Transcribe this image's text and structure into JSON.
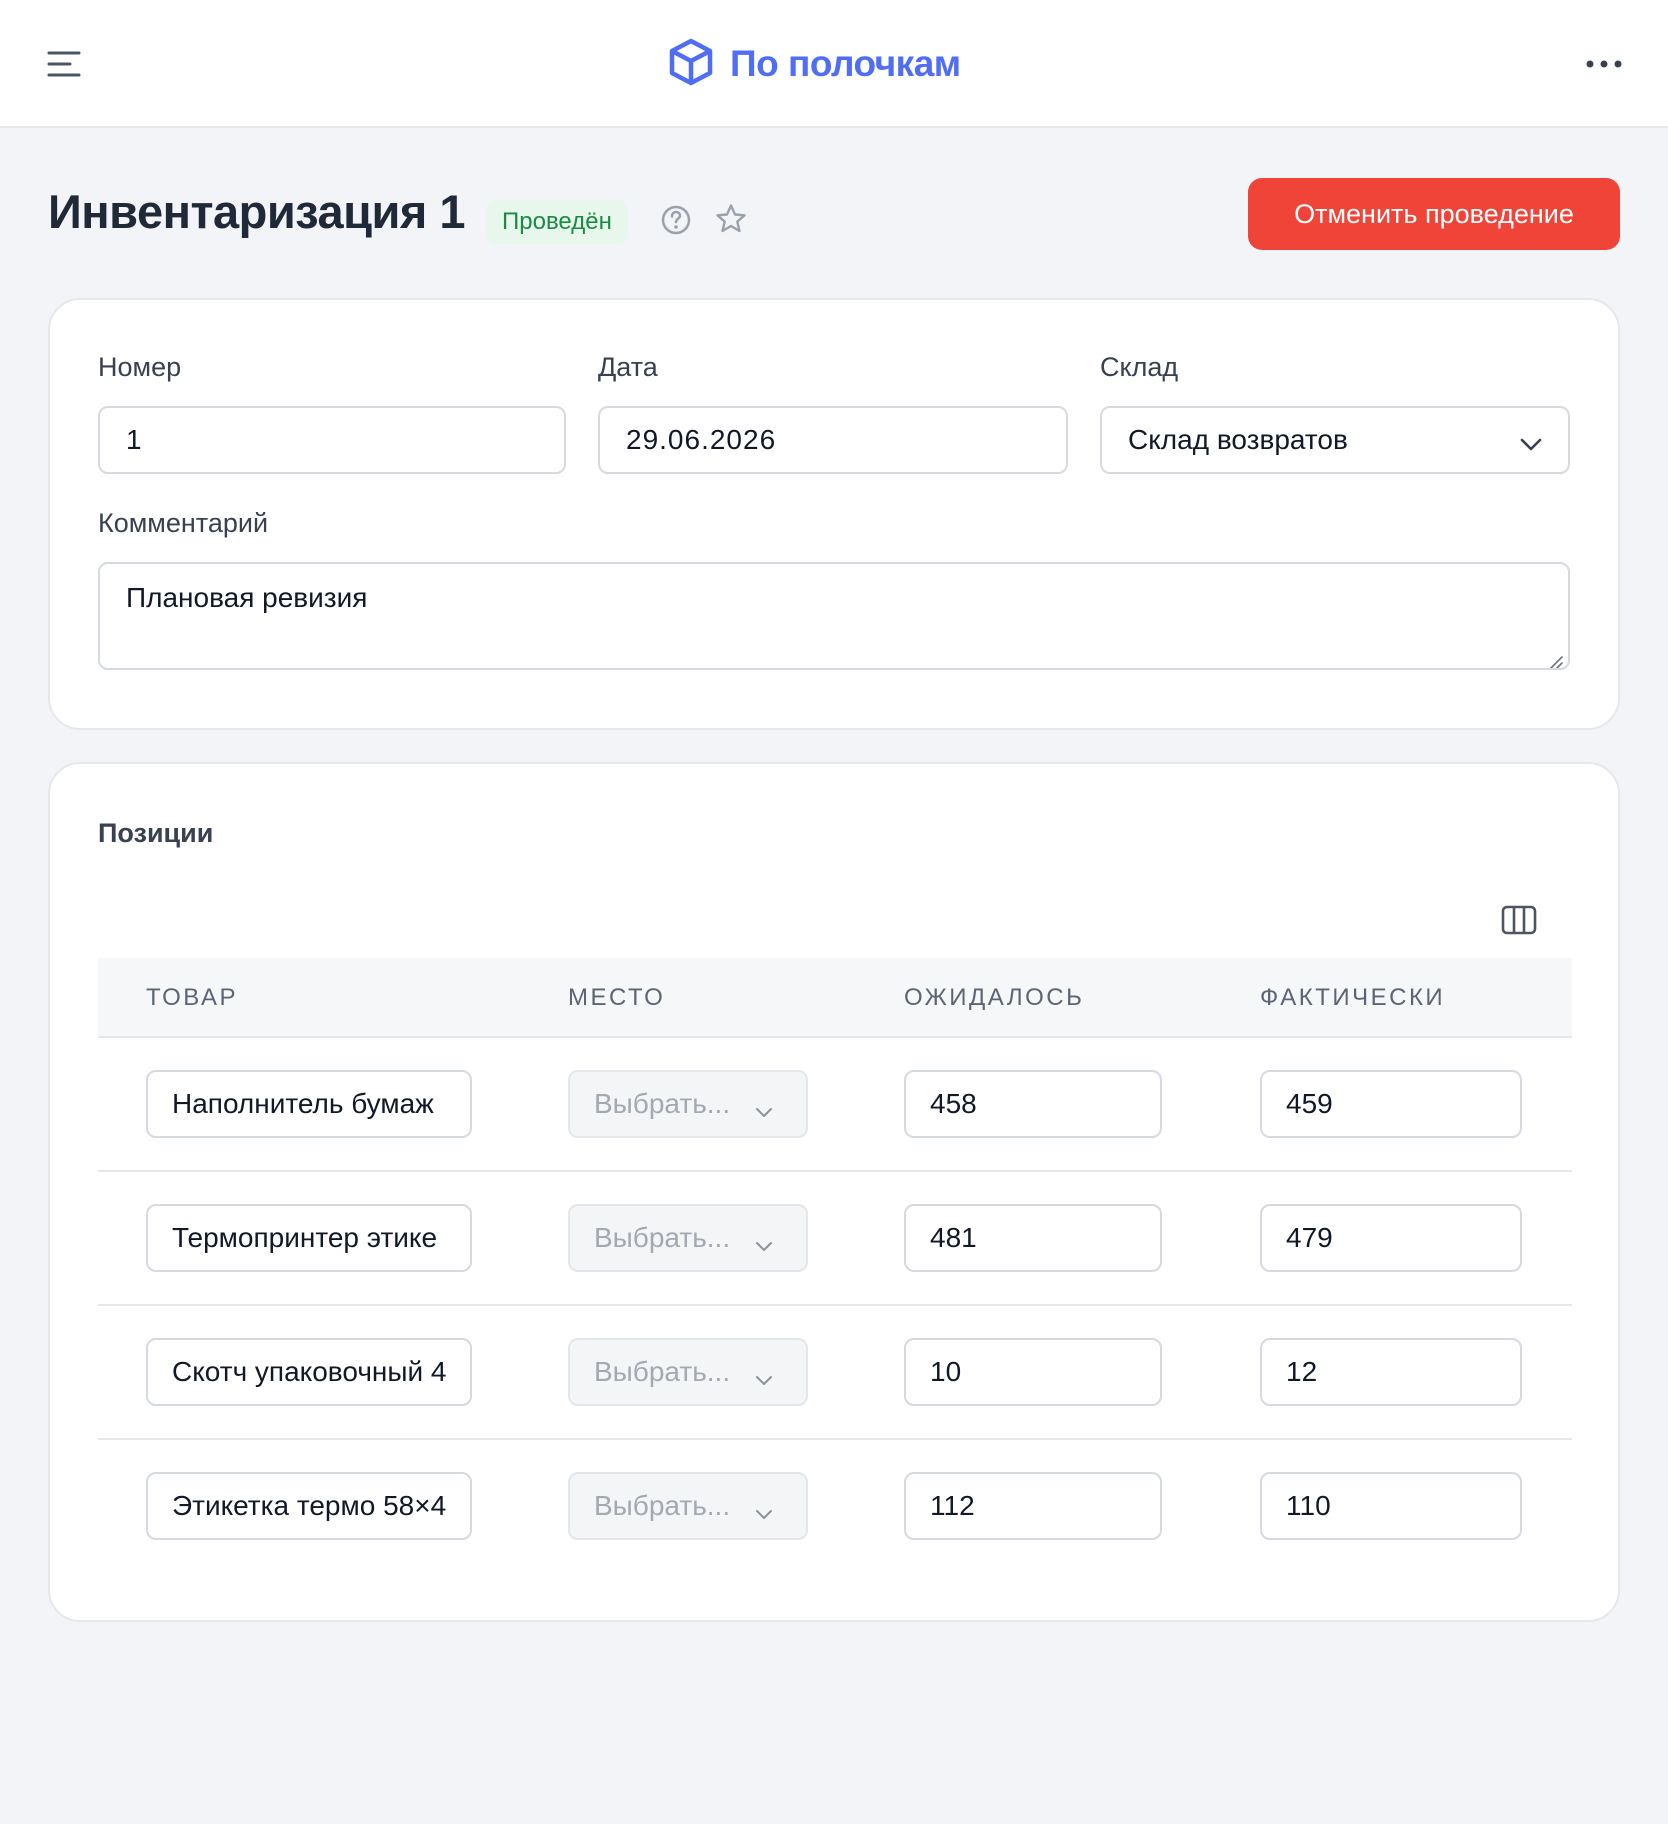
{
  "header": {
    "brand": "По полочкам",
    "icons": {
      "menu": "menu-icon",
      "logo": "box-icon",
      "more": "more-horizontal-icon"
    }
  },
  "page": {
    "title": "Инвентаризация 1",
    "status": "Проведён",
    "cancel_label": "Отменить проведение",
    "colors": {
      "accent": "#4f6df5",
      "danger": "#f04438",
      "success_bg": "#e8f7ec",
      "success_text": "#1a8a45"
    }
  },
  "form": {
    "number_label": "Номер",
    "number_value": "1",
    "date_label": "Дата",
    "date_value": "29.06.2026",
    "warehouse_label": "Склад",
    "warehouse_value": "Склад возвратов",
    "comment_label": "Комментарий",
    "comment_value": "Плановая ревизия"
  },
  "positions": {
    "title": "Позиции",
    "columns": [
      "Товар",
      "Место",
      "Ожидалось",
      "Фактически"
    ],
    "rows": [
      {
        "product": "Наполнитель бумаж",
        "place": "Выбрать...",
        "expected": "458",
        "actual": "459"
      },
      {
        "product": "Термопринтер этике",
        "place": "Выбрать...",
        "expected": "481",
        "actual": "479"
      },
      {
        "product": "Скотч упаковочный 4",
        "place": "Выбрать...",
        "expected": "10",
        "actual": "12"
      },
      {
        "product": "Этикетка термо 58×4",
        "place": "Выбрать...",
        "expected": "112",
        "actual": "110"
      }
    ]
  }
}
